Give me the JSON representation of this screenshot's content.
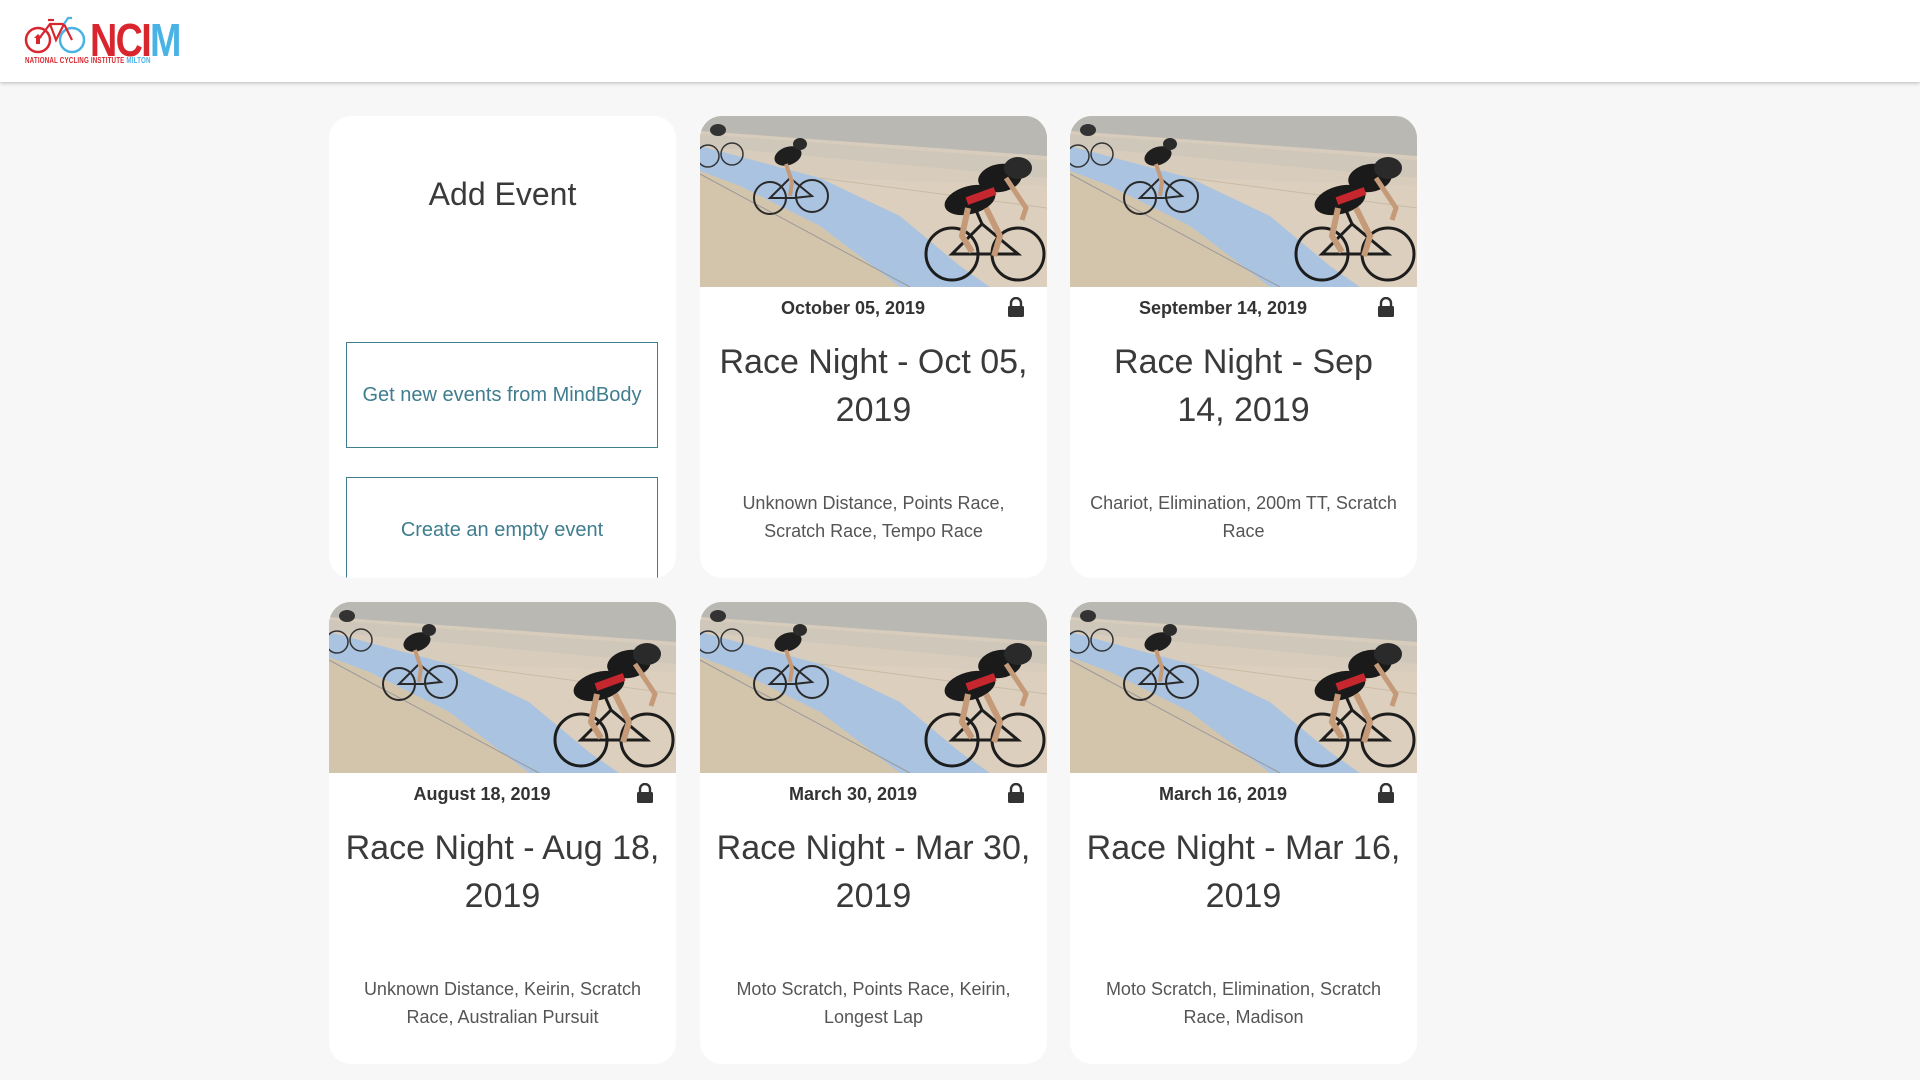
{
  "header": {
    "logo": {
      "wordmark_red": "NC",
      "wordmark_mid": "I",
      "wordmark_blue": "M",
      "subtitle_red": "NATIONAL CYCLING INSTITUTE",
      "subtitle_blue": "MILTON"
    }
  },
  "add_event": {
    "title": "Add Event",
    "mindbody_button": "Get new events from MindBody",
    "empty_button": "Create an empty event"
  },
  "events": [
    {
      "date": "October 05, 2019",
      "title": "Race Night - Oct 05, 2019",
      "races": "Unknown Distance, Points Race, Scratch Race, Tempo Race",
      "locked": true
    },
    {
      "date": "September 14, 2019",
      "title": "Race Night - Sep 14, 2019",
      "races": "Chariot, Elimination, 200m TT, Scratch Race",
      "locked": true
    },
    {
      "date": "August 18, 2019",
      "title": "Race Night - Aug 18, 2019",
      "races": "Unknown Distance, Keirin, Scratch Race, Australian Pursuit",
      "locked": true
    },
    {
      "date": "March 30, 2019",
      "title": "Race Night - Mar 30, 2019",
      "races": "Moto Scratch, Points Race, Keirin, Longest Lap",
      "locked": true
    },
    {
      "date": "March 16, 2019",
      "title": "Race Night - Mar 16, 2019",
      "races": "Moto Scratch, Elimination, Scratch Race, Madison",
      "locked": true
    }
  ],
  "colors": {
    "brand_red": "#d9262e",
    "brand_blue": "#4ab3e6",
    "button_teal": "#3f7d8f",
    "page_bg": "#f7f7f7"
  }
}
